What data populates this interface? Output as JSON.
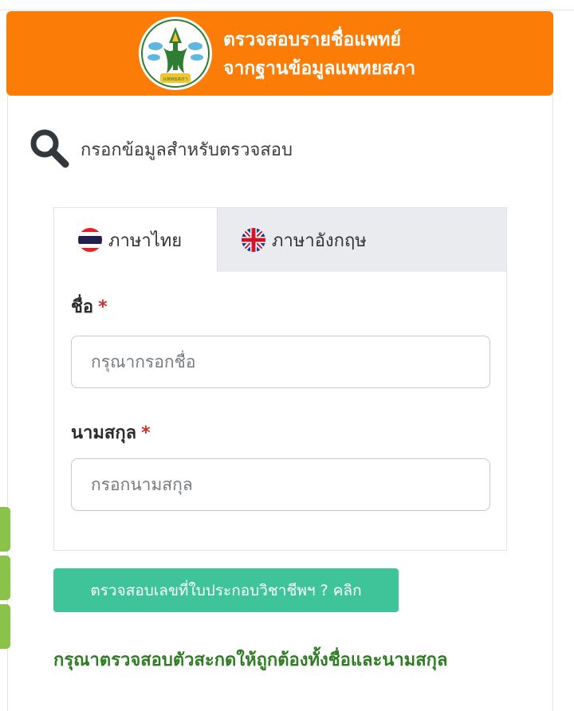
{
  "colors": {
    "header_bg": "#fb7c06",
    "button_bg": "#3fc49a",
    "notice_text": "#2e7d23",
    "required_mark": "#c9302c",
    "side_tabs": "#8bc34a"
  },
  "header": {
    "title_line1": "ตรวจสอบรายชื่อแพทย์",
    "title_line2": "จากฐานข้อมูลแพทยสภา",
    "logo_icon": "medical-council-seal"
  },
  "search": {
    "icon": "search-icon",
    "title": "กรอกข้อมูลสำหรับตรวจสอบ"
  },
  "tabs": [
    {
      "label": "ภาษาไทย",
      "icon": "thai-flag-icon",
      "active": true
    },
    {
      "label": "ภาษาอังกฤษ",
      "icon": "uk-flag-icon",
      "active": false
    }
  ],
  "form": {
    "first_name": {
      "label": "ชื่อ",
      "required_mark": "*",
      "placeholder": "กรุณากรอกชื่อ",
      "value": ""
    },
    "last_name": {
      "label": "นามสกุล",
      "required_mark": "*",
      "placeholder": "กรอกนามสกุล",
      "value": ""
    }
  },
  "verify_button": {
    "label": "ตรวจสอบเลขที่ใบประกอบวิชาชีพฯ ? คลิก"
  },
  "notice": {
    "text": "กรุณาตรวจสอบตัวสะกดให้ถูกต้องทั้งชื่อและนามสกุล"
  }
}
